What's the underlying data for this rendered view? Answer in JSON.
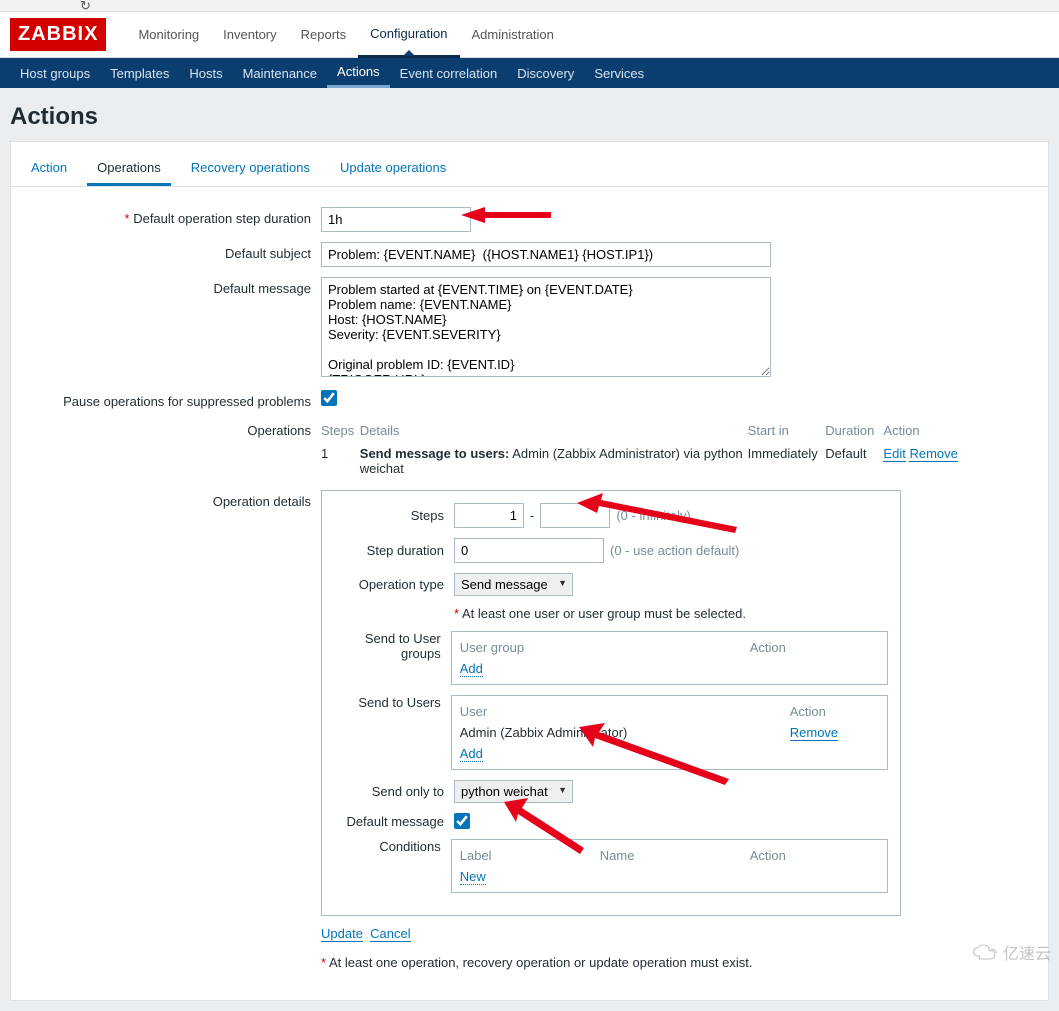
{
  "logo_text": "ZABBIX",
  "topnav": [
    {
      "label": "Monitoring"
    },
    {
      "label": "Inventory"
    },
    {
      "label": "Reports"
    },
    {
      "label": "Configuration",
      "active": true
    },
    {
      "label": "Administration"
    }
  ],
  "subnav": [
    {
      "label": "Host groups"
    },
    {
      "label": "Templates"
    },
    {
      "label": "Hosts"
    },
    {
      "label": "Maintenance"
    },
    {
      "label": "Actions",
      "active": true
    },
    {
      "label": "Event correlation"
    },
    {
      "label": "Discovery"
    },
    {
      "label": "Services"
    }
  ],
  "page_title": "Actions",
  "tabs": [
    {
      "label": "Action"
    },
    {
      "label": "Operations",
      "active": true
    },
    {
      "label": "Recovery operations"
    },
    {
      "label": "Update operations"
    }
  ],
  "form": {
    "step_duration_label": "Default operation step duration",
    "step_duration_value": "1h",
    "subject_label": "Default subject",
    "subject_value": "Problem: {EVENT.NAME}  ({HOST.NAME1} {HOST.IP1})",
    "message_label": "Default message",
    "message_value": "Problem started at {EVENT.TIME} on {EVENT.DATE}\nProblem name: {EVENT.NAME}\nHost: {HOST.NAME}\nSeverity: {EVENT.SEVERITY}\n\nOriginal problem ID: {EVENT.ID}\n{TRIGGER.URL}",
    "pause_label": "Pause operations for suppressed problems",
    "operations_label": "Operations",
    "op_table": {
      "headers": {
        "steps": "Steps",
        "details": "Details",
        "startin": "Start in",
        "duration": "Duration",
        "action": "Action"
      },
      "row": {
        "steps": "1",
        "details_bold": "Send message to users:",
        "details_rest": " Admin (Zabbix Administrator) via python weichat",
        "startin": "Immediately",
        "duration": "Default",
        "edit": "Edit",
        "remove": "Remove"
      }
    },
    "opdetail_label": "Operation details",
    "od": {
      "steps_label": "Steps",
      "steps_from": "1",
      "steps_to": "",
      "steps_hint": "(0 - infinitely)",
      "dur_label": "Step duration",
      "dur_value": "0",
      "dur_hint": "(0 - use action default)",
      "type_label": "Operation type",
      "type_value": "Send message",
      "type_note": "At least one user or user group must be selected.",
      "ugroups_label": "Send to User groups",
      "ugroups_h1": "User group",
      "ugroups_h2": "Action",
      "ugroups_add": "Add",
      "users_label": "Send to Users",
      "users_h1": "User",
      "users_h2": "Action",
      "users_name": "Admin (Zabbix Administrator)",
      "users_remove": "Remove",
      "users_add": "Add",
      "sendonly_label": "Send only to",
      "sendonly_value": "python weichat",
      "defmsg_label": "Default message",
      "cond_label": "Conditions",
      "cond_h1": "Label",
      "cond_h2": "Name",
      "cond_h3": "Action",
      "cond_new": "New"
    },
    "update_label": "Update",
    "cancel_label": "Cancel",
    "bottom_note": "At least one operation, recovery operation or update operation must exist."
  },
  "footer_brand": "亿速云"
}
